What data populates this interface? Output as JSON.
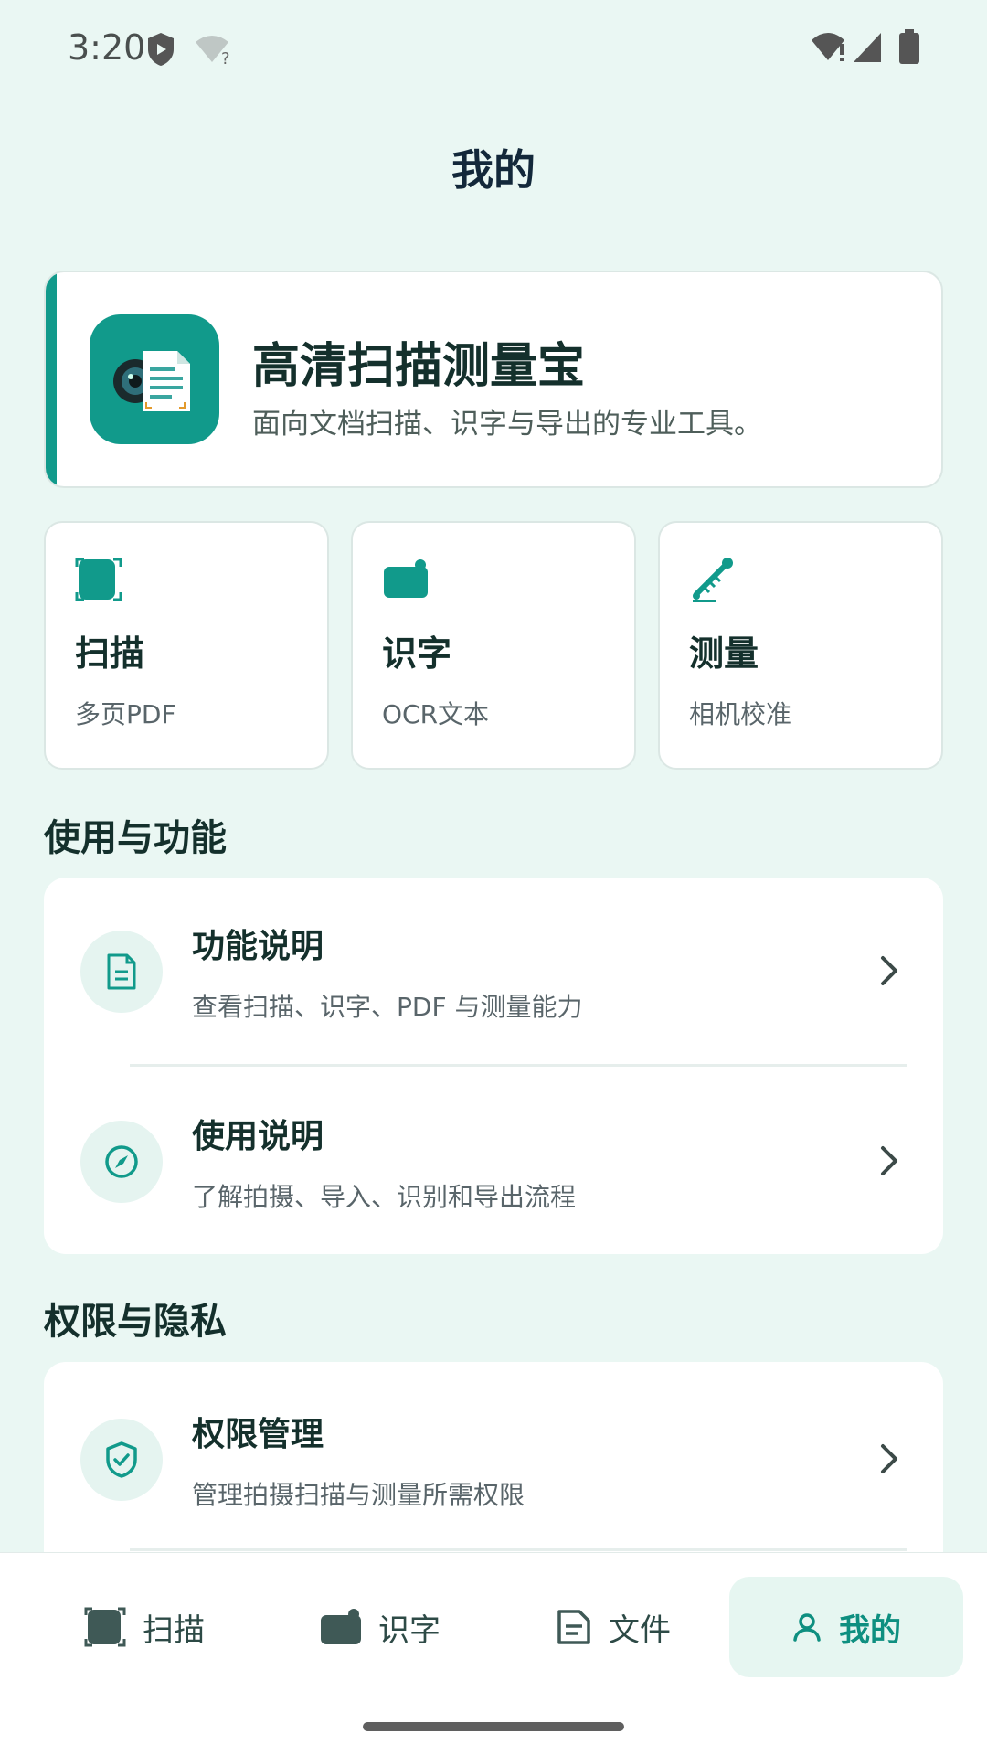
{
  "status_bar": {
    "time": "3:20"
  },
  "page": {
    "title": "我的"
  },
  "brand": {
    "name": "高清扫描测量宝",
    "description": "面向文档扫描、识字与导出的专业工具。",
    "logo_icon": "camera-document-icon"
  },
  "feature_tiles": [
    {
      "title": "扫描",
      "subtitle": "多页PDF",
      "icon": "scan-icon"
    },
    {
      "title": "识字",
      "subtitle": "OCR文本",
      "icon": "camera-icon"
    },
    {
      "title": "测量",
      "subtitle": "相机校准",
      "icon": "ruler-icon"
    }
  ],
  "sections": {
    "usage": {
      "title": "使用与功能",
      "items": [
        {
          "title": "功能说明",
          "subtitle": "查看扫描、识字、PDF 与测量能力",
          "icon": "document-icon"
        },
        {
          "title": "使用说明",
          "subtitle": "了解拍摄、导入、识别和导出流程",
          "icon": "compass-icon"
        }
      ]
    },
    "privacy": {
      "title": "权限与隐私",
      "items": [
        {
          "title": "权限管理",
          "subtitle": "管理拍摄扫描与测量所需权限",
          "icon": "shield-check-icon"
        }
      ]
    }
  },
  "bottom_nav": {
    "items": [
      {
        "label": "扫描",
        "icon": "scan-icon",
        "active": false
      },
      {
        "label": "识字",
        "icon": "camera-icon",
        "active": false
      },
      {
        "label": "文件",
        "icon": "file-icon",
        "active": false
      },
      {
        "label": "我的",
        "icon": "person-icon",
        "active": true
      }
    ]
  },
  "colors": {
    "accent": "#119a8b",
    "background": "#eaf7f3",
    "card": "#ffffff",
    "text_primary": "#14302c",
    "text_secondary": "#59656a"
  }
}
